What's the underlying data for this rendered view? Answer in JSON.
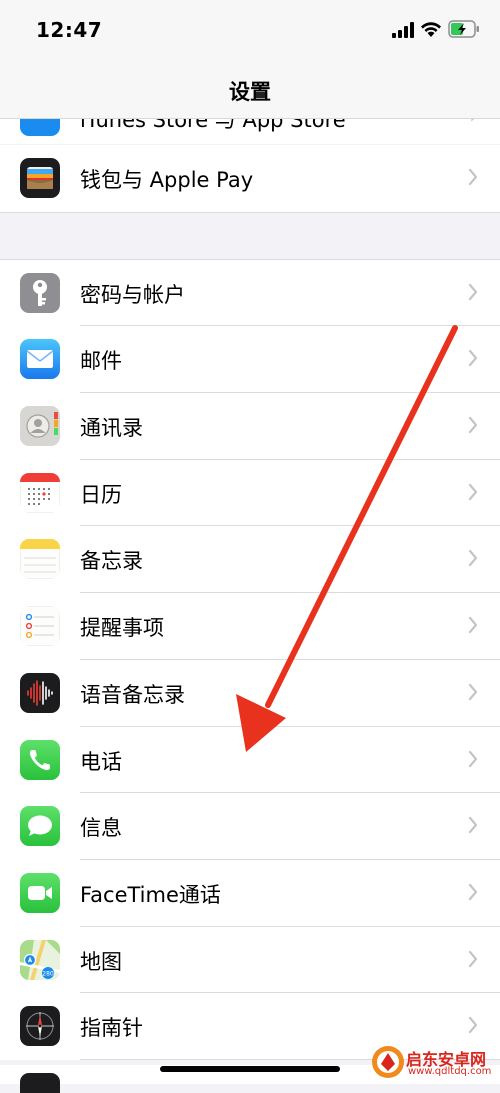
{
  "status_bar": {
    "time": "12:47"
  },
  "nav": {
    "title": "设置"
  },
  "peek_row": {
    "label": "iTunes Store 与 App Store"
  },
  "rows_top": [
    {
      "id": "wallet",
      "label": "钱包与 Apple Pay",
      "icon": "wallet-icon"
    }
  ],
  "rows": [
    {
      "id": "passwords",
      "label": "密码与帐户",
      "icon": "key-icon"
    },
    {
      "id": "mail",
      "label": "邮件",
      "icon": "mail-icon"
    },
    {
      "id": "contacts",
      "label": "通讯录",
      "icon": "contacts-icon"
    },
    {
      "id": "calendar",
      "label": "日历",
      "icon": "calendar-icon"
    },
    {
      "id": "notes",
      "label": "备忘录",
      "icon": "notes-icon"
    },
    {
      "id": "reminders",
      "label": "提醒事项",
      "icon": "reminders-icon"
    },
    {
      "id": "voice-memos",
      "label": "语音备忘录",
      "icon": "voice-memos-icon"
    },
    {
      "id": "phone",
      "label": "电话",
      "icon": "phone-icon"
    },
    {
      "id": "messages",
      "label": "信息",
      "icon": "messages-icon"
    },
    {
      "id": "facetime",
      "label": "FaceTime通话",
      "icon": "facetime-icon"
    },
    {
      "id": "maps",
      "label": "地图",
      "icon": "maps-icon"
    },
    {
      "id": "compass",
      "label": "指南针",
      "icon": "compass-icon"
    }
  ],
  "annotation": {
    "color": "#e8321e"
  },
  "watermark": {
    "title": "启东安卓网",
    "url": "www.qdltdq.com"
  }
}
